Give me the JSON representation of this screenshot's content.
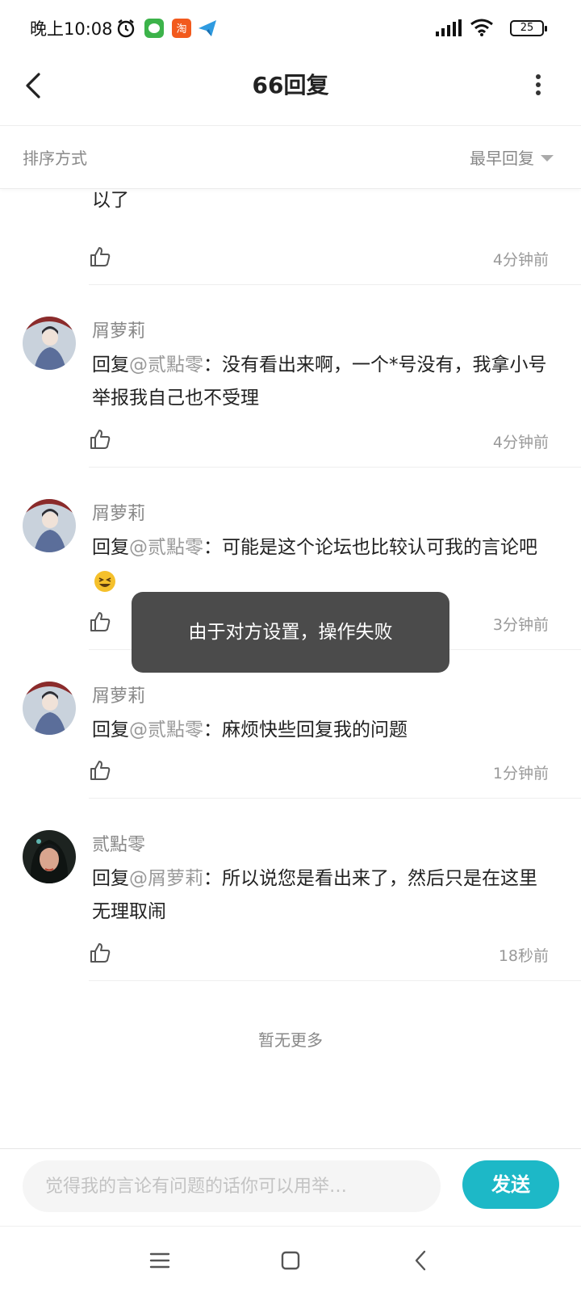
{
  "status_bar": {
    "time": "晚上10:08",
    "battery": "25"
  },
  "header": {
    "title": "66回复"
  },
  "sort": {
    "label": "排序方式",
    "value": "最早回复"
  },
  "partial_comment": {
    "text": "现在你只需要回复我有什么管理评论区的手段就可以了",
    "visible_tail": "以了",
    "time": "4分钟前"
  },
  "comments": [
    {
      "author": "屑萝莉",
      "prefix": "回复",
      "mention": "@贰點零",
      "text": "：没有看出来啊，一个*号没有，我拿小号举报我自己也不受理",
      "time": "4分钟前"
    },
    {
      "author": "屑萝莉",
      "prefix": "回复",
      "mention": "@贰點零",
      "text": "：可能是这个论坛也比较认可我的言论吧",
      "time": "3分钟前"
    },
    {
      "author": "屑萝莉",
      "prefix": "回复",
      "mention": "@贰點零",
      "text": "：麻烦快些回复我的问题",
      "time": "1分钟前"
    },
    {
      "author": "贰點零",
      "prefix": "回复",
      "mention": "@屑萝莉",
      "text": "：所以说您是看出来了，然后只是在这里无理取闹",
      "time": "18秒前"
    }
  ],
  "no_more": "暂无更多",
  "toast": "由于对方设置，操作失败",
  "input": {
    "placeholder": "觉得我的言论有问题的话你可以用举…"
  },
  "send_label": "发送",
  "colors": {
    "accent": "#1db8c7",
    "toast_bg": "#444444",
    "secondary_text": "#888888"
  },
  "icons": [
    "alarm-icon",
    "wechat-icon",
    "taobao-icon",
    "telegram-icon",
    "signal-icon",
    "wifi-icon",
    "battery-icon",
    "back-icon",
    "more-icon",
    "thumbs-up-icon",
    "laughing-emoji-icon",
    "menu-icon",
    "home-icon",
    "nav-back-icon"
  ]
}
